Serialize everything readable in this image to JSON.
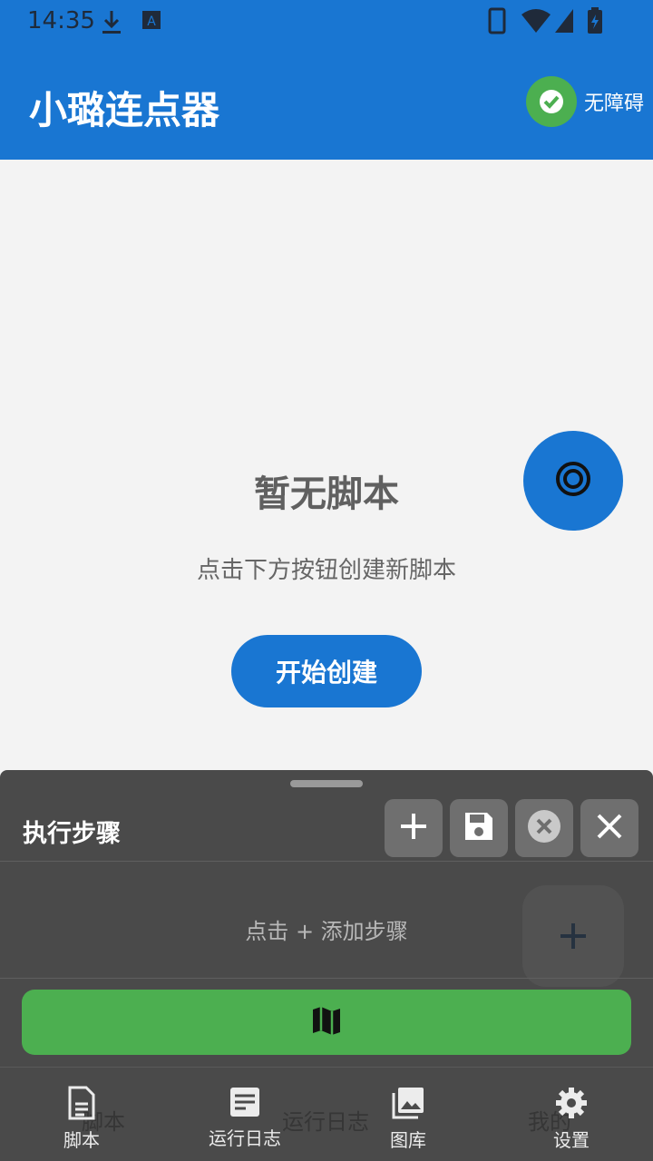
{
  "status_bar": {
    "time": "14:35"
  },
  "app_bar": {
    "title": "小璐连点器",
    "accessibility_label": "无障碍"
  },
  "empty_state": {
    "title": "暂无脚本",
    "subtitle": "点击下方按钮创建新脚本",
    "start_button": "开始创建"
  },
  "sheet": {
    "title": "执行步骤",
    "hint": "点击 + 添加步骤",
    "tools": [
      "plus-icon",
      "save-icon",
      "clear-icon",
      "close-icon"
    ]
  },
  "nav": {
    "items": [
      {
        "label": "脚本",
        "icon": "script-icon"
      },
      {
        "label": "运行日志",
        "icon": "log-icon"
      },
      {
        "label": "图库",
        "icon": "gallery-icon"
      },
      {
        "label": "设置",
        "icon": "gear-icon"
      }
    ],
    "ghost_labels": [
      "脚本",
      "运行日志",
      "我的"
    ]
  },
  "colors": {
    "primary": "#1976d2",
    "success": "#4caf50",
    "sheet": "#4a4a4a"
  }
}
